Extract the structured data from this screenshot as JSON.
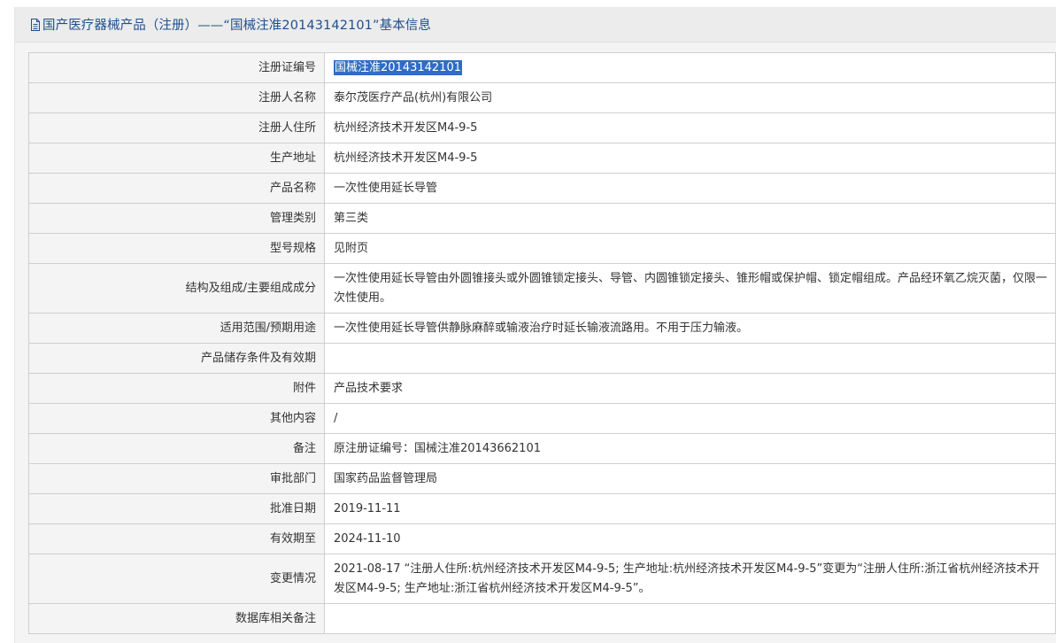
{
  "header": {
    "title": "国产医疗器械产品（注册）——“国械注准20143142101”基本信息"
  },
  "rows": [
    {
      "label": "注册证编号",
      "value": "国械注准20143142101"
    },
    {
      "label": "注册人名称",
      "value": "泰尔茂医疗产品(杭州)有限公司"
    },
    {
      "label": "注册人住所",
      "value": "杭州经济技术开发区M4-9-5"
    },
    {
      "label": "生产地址",
      "value": "杭州经济技术开发区M4-9-5"
    },
    {
      "label": "产品名称",
      "value": "一次性使用延长导管"
    },
    {
      "label": "管理类别",
      "value": "第三类"
    },
    {
      "label": "型号规格",
      "value": "见附页"
    },
    {
      "label": "结构及组成/主要组成成分",
      "value": "一次性使用延长导管由外圆锥接头或外圆锥锁定接头、导管、内圆锥锁定接头、锥形帽或保护帽、锁定帽组成。产品经环氧乙烷灭菌，仅限一次性使用。"
    },
    {
      "label": "适用范围/预期用途",
      "value": "一次性使用延长导管供静脉麻醉或输液治疗时延长输液流路用。不用于压力输液。"
    },
    {
      "label": "产品储存条件及有效期",
      "value": ""
    },
    {
      "label": "附件",
      "value": "产品技术要求"
    },
    {
      "label": "其他内容",
      "value": "/"
    },
    {
      "label": "备注",
      "value": "原注册证编号：国械注准20143662101"
    },
    {
      "label": "审批部门",
      "value": "国家药品监督管理局"
    },
    {
      "label": "批准日期",
      "value": "2019-11-11"
    },
    {
      "label": "有效期至",
      "value": "2024-11-10"
    },
    {
      "label": "变更情况",
      "value": "2021-08-17 “注册人住所:杭州经济技术开发区M4-9-5; 生产地址:杭州经济技术开发区M4-9-5”变更为“注册人住所:浙江省杭州经济技术开发区M4-9-5; 生产地址:浙江省杭州经济技术开发区M4-9-5”。"
    },
    {
      "label": "数据库相关备注",
      "value": ""
    }
  ]
}
